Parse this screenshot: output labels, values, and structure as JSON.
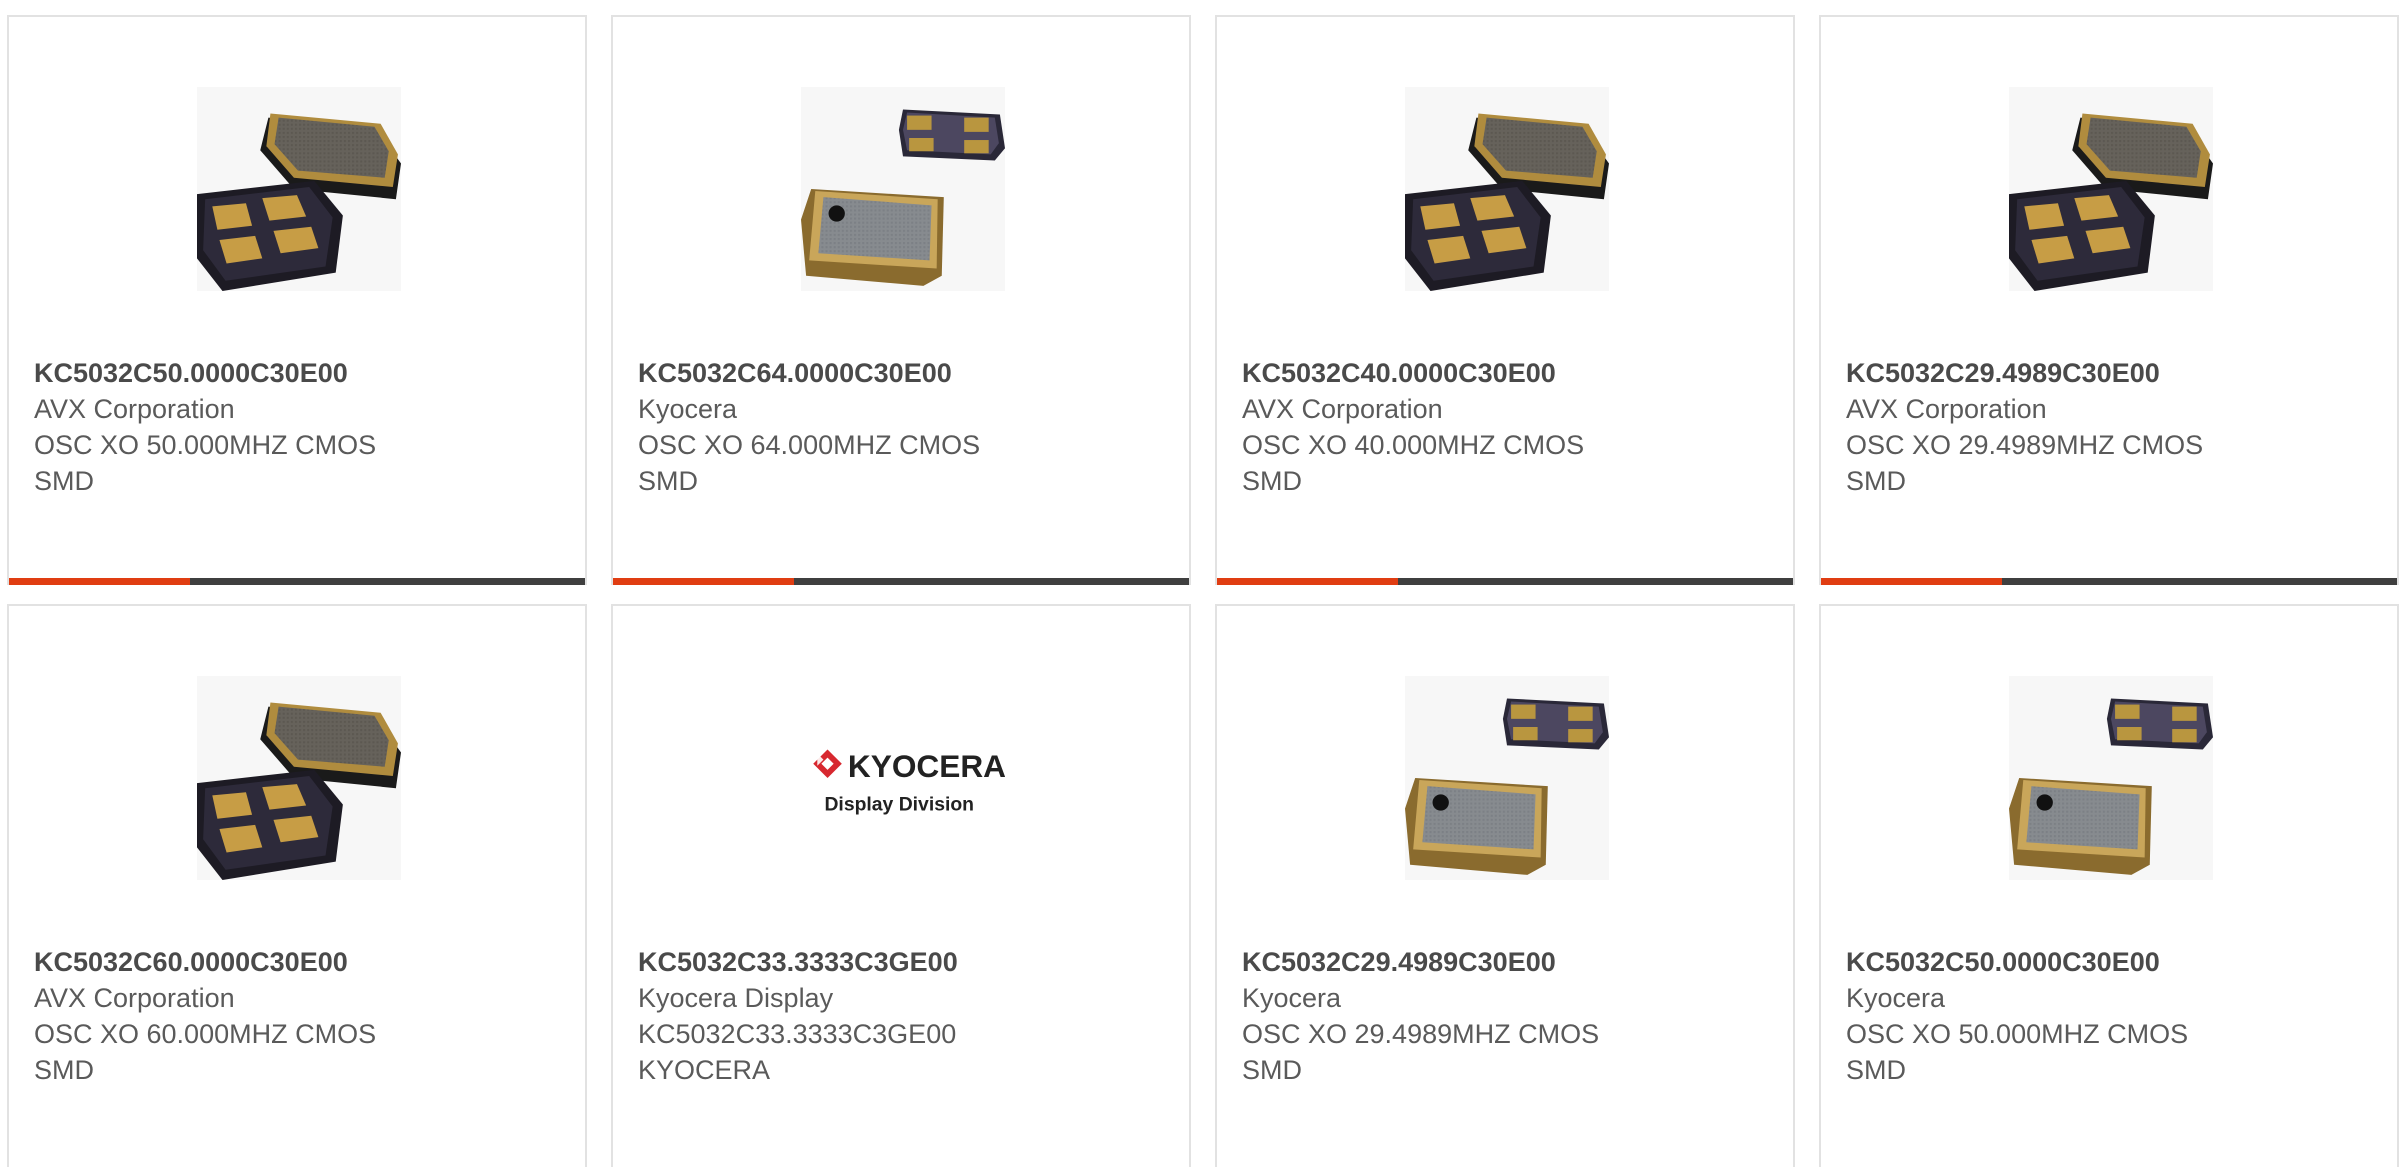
{
  "colors": {
    "accent": "#e03d12",
    "bar_dark": "#3f3f3f",
    "card_border": "#e2e2e2"
  },
  "products": [
    {
      "part_number": "KC5032C50.0000C30E00",
      "manufacturer": "AVX Corporation",
      "description": "OSC XO 50.000MHZ CMOS",
      "package": "SMD",
      "image": "avx-crystal-icon"
    },
    {
      "part_number": "KC5032C64.0000C30E00",
      "manufacturer": "Kyocera",
      "description": "OSC XO 64.000MHZ CMOS",
      "package": "SMD",
      "image": "kyocera-crystal-icon"
    },
    {
      "part_number": "KC5032C40.0000C30E00",
      "manufacturer": "AVX Corporation",
      "description": "OSC XO 40.000MHZ CMOS",
      "package": "SMD",
      "image": "avx-crystal-icon"
    },
    {
      "part_number": "KC5032C29.4989C30E00",
      "manufacturer": "AVX Corporation",
      "description": "OSC XO 29.4989MHZ CMOS",
      "package": "SMD",
      "image": "avx-crystal-icon"
    },
    {
      "part_number": "KC5032C60.0000C30E00",
      "manufacturer": "AVX Corporation",
      "description": "OSC XO 60.000MHZ CMOS",
      "package": "SMD",
      "image": "avx-crystal-icon"
    },
    {
      "part_number": "KC5032C33.3333C3GE00",
      "manufacturer": "Kyocera Display",
      "description": "KC5032C33.3333C3GE00",
      "package": "KYOCERA",
      "image": "kyocera-display-logo",
      "logo_text": {
        "brand": "KYOCERA",
        "sub": "Display Division"
      }
    },
    {
      "part_number": "KC5032C29.4989C30E00",
      "manufacturer": "Kyocera",
      "description": "OSC XO 29.4989MHZ CMOS",
      "package": "SMD",
      "image": "kyocera-crystal-icon"
    },
    {
      "part_number": "KC5032C50.0000C30E00",
      "manufacturer": "Kyocera",
      "description": "OSC XO 50.000MHZ CMOS",
      "package": "SMD",
      "image": "kyocera-crystal-icon"
    }
  ]
}
